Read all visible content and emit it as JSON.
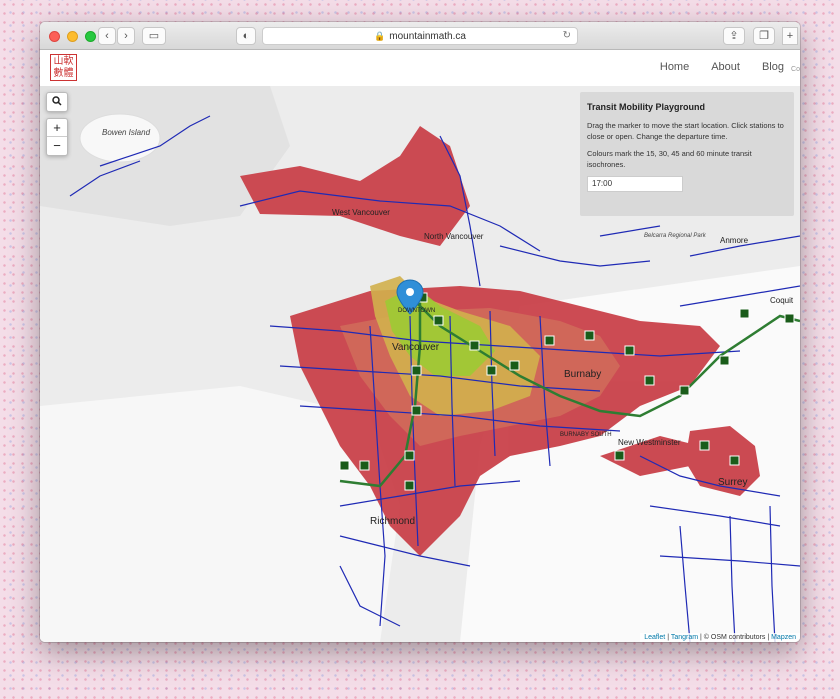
{
  "browser": {
    "url": "mountainmath.ca",
    "tab_add": "+"
  },
  "site": {
    "logo_text": "山軟數體",
    "nav": [
      "Home",
      "About",
      "Blog"
    ],
    "nav_extra": "Co"
  },
  "map": {
    "search_icon": "search-icon",
    "zoom_in": "+",
    "zoom_out": "−",
    "panel": {
      "title": "Transit Mobility Playground",
      "instructions": "Drag the marker to move the start location. Click stations to close or open. Change the departure time.",
      "legend_text": "Colours mark the 15, 30, 45 and 60 minute transit isochrones.",
      "departure_time": "17:00"
    },
    "labels": {
      "bowen": "Bowen Island",
      "west_vancouver": "West Vancouver",
      "north_vancouver": "North Vancouver",
      "downtown": "DOWNTOWN",
      "vancouver": "Vancouver",
      "burnaby": "Burnaby",
      "burnaby_south": "BURNABY SOUTH",
      "new_westminster": "New Westminster",
      "richmond": "Richmond",
      "surrey": "Surrey",
      "belcarra": "Belcarra Regional Park",
      "anmore": "Anmore",
      "coquitlam": "Coquit"
    },
    "attribution": {
      "leaflet": "Leaflet",
      "tangram": "Tangram",
      "osm": "© OSM contributors",
      "mapzen": "Mapzen"
    },
    "isochrone_colors": {
      "m15": "#9acd32",
      "m30": "#d2b04c",
      "m45": "#d06a5a",
      "m60": "#c9414a"
    },
    "marker_color": "#2f8fd8",
    "route_color": "#1f2ab5",
    "station_color": "#1a5c1a"
  }
}
